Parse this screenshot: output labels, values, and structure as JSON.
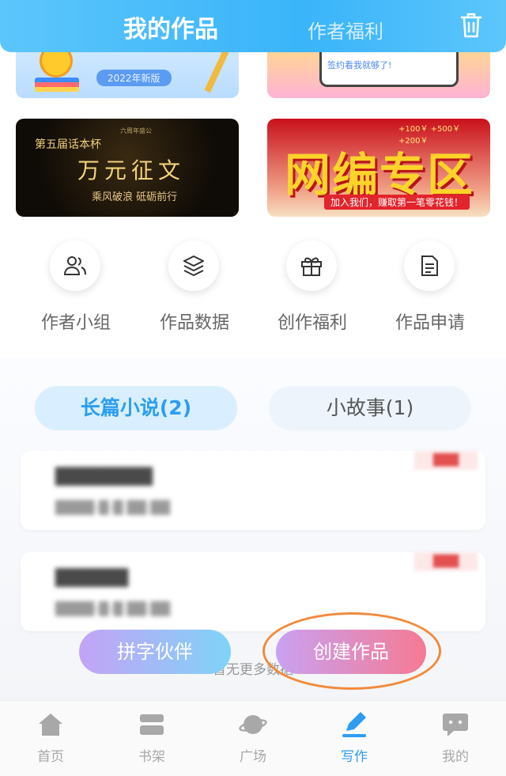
{
  "header": {
    "tabs": [
      {
        "label": "我的作品",
        "active": true
      },
      {
        "label": "作者福利",
        "active": false
      }
    ],
    "trash_icon": "trash-icon"
  },
  "banners": {
    "b1": {
      "edition": "2022年新版"
    },
    "b2": {
      "note_text": "签约看我就够了!"
    },
    "b3": {
      "top_text": "六周年盛公",
      "left_text": "第五届话本杯",
      "title": "万元征文",
      "subtitle": "乘风破浪 砥砺前行"
    },
    "b4": {
      "coins_text": "+100￥ +500￥ +200￥",
      "title": "网编专区",
      "subtitle": "加入我们，赚取第一笔零花钱！"
    }
  },
  "quick_actions": [
    {
      "label": "作者小组",
      "icon": "users-icon"
    },
    {
      "label": "作品数据",
      "icon": "layers-icon"
    },
    {
      "label": "创作福利",
      "icon": "gift-icon"
    },
    {
      "label": "作品申请",
      "icon": "document-icon"
    }
  ],
  "work_tabs": [
    {
      "label": "长篇小说(2)",
      "active": true
    },
    {
      "label": "小故事(1)",
      "active": false
    }
  ],
  "works": [
    {
      "title": "████████",
      "time": "████-█-█ ██:██",
      "badge": "███"
    },
    {
      "title": "██████",
      "time": "████-█-█ ██:██",
      "badge": "███"
    }
  ],
  "footer_hint": "暂无更多数据",
  "actions": {
    "partner_label": "拼字伙伴",
    "create_label": "创建作品"
  },
  "tabbar": [
    {
      "label": "首页",
      "icon": "home-icon",
      "active": false
    },
    {
      "label": "书架",
      "icon": "bookshelf-icon",
      "active": false
    },
    {
      "label": "广场",
      "icon": "planet-icon",
      "active": false
    },
    {
      "label": "写作",
      "icon": "pen-icon",
      "active": true
    },
    {
      "label": "我的",
      "icon": "chat-bubble-icon",
      "active": false
    }
  ],
  "colors": {
    "accent": "#2e9cf2",
    "header": "#3ab4fa",
    "highlight_ring": "#f28a3a"
  }
}
